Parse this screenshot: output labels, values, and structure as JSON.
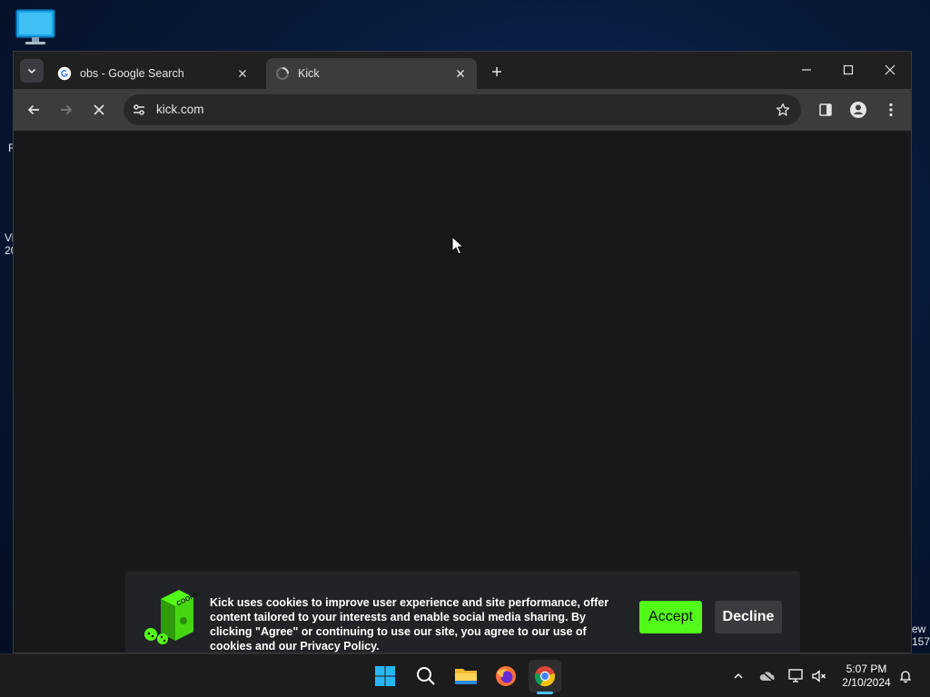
{
  "desktop": {
    "fragments": [
      "R",
      "Vi",
      "20",
      "ew",
      "157"
    ]
  },
  "browser": {
    "tabs": [
      {
        "title": "obs - Google Search",
        "favicon": "google-g-icon",
        "active": false
      },
      {
        "title": "Kick",
        "favicon": "kick-loading-icon",
        "active": true
      }
    ],
    "toolbar": {
      "url": "kick.com",
      "back_icon": "arrow-left-icon",
      "forward_icon": "arrow-right-icon",
      "stop_icon": "close-icon",
      "site_info_icon": "tune-icon",
      "bookmark_icon": "star-icon",
      "side_panel_icon": "side-panel-icon",
      "profile_icon": "person-icon",
      "menu_icon": "more-vertical-icon"
    }
  },
  "cookie_banner": {
    "message": "Kick uses cookies to improve user experience and site performance, offer content tailored to your interests and enable social media sharing. By clicking \"Agree\" or continuing to use our site, you agree to our use of cookies and our Privacy Policy.",
    "accept_label": "Accept",
    "decline_label": "Decline",
    "image_label": "COOKIE",
    "colors": {
      "accept": "#53fc18",
      "background": "#222326",
      "decline": "#3a3b3e"
    }
  },
  "taskbar": {
    "apps": [
      "windows-start-icon",
      "search-icon",
      "file-explorer-icon",
      "firefox-icon",
      "chrome-icon"
    ],
    "tray": [
      "chevron-up-icon",
      "onedrive-icon",
      "network-icon",
      "volume-muted-icon",
      "notification-bell-icon"
    ],
    "time": "5:07 PM",
    "date": "2/10/2024",
    "accent": "#4cc2ff"
  }
}
